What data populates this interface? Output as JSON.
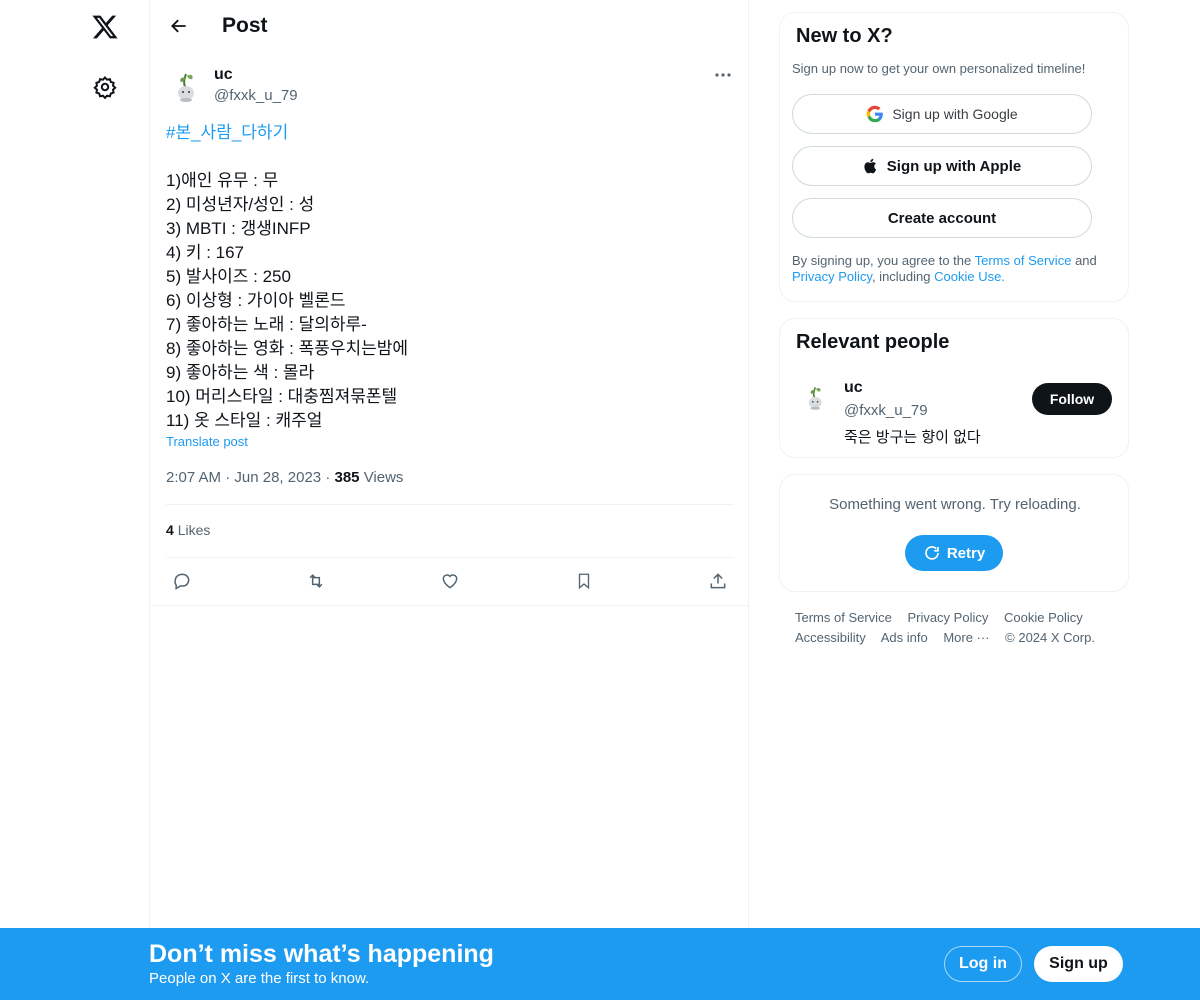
{
  "nav": {
    "logo_icon": "x-logo-icon",
    "settings_icon": "gear-icon"
  },
  "header": {
    "title": "Post"
  },
  "post": {
    "author_name": "uc",
    "author_handle": "@fxxk_u_79",
    "hashtag": "#본_사람_다하기",
    "lines": [
      "1)애인 유무 : 무",
      "2) 미성년자/성인 : 성",
      "3) MBTI : 갱생INFP",
      "4) 키 : 167",
      "5) 발사이즈 : 250",
      "6) 이상형 : 가이아 벨론드",
      "7) 좋아하는 노래 : 달의하루-",
      "8) 좋아하는 영화 : 폭풍우치는밤에",
      "9) 좋아하는 색 : 몰라",
      "10) 머리스타일 : 대충찜져묶폰텔",
      "11) 옷 스타일 : 캐주얼"
    ],
    "translate_label": "Translate post",
    "time": "2:07 AM",
    "date": "Jun 28, 2023",
    "views_count": "385",
    "views_label": "Views",
    "likes_count": "4",
    "likes_label": "Likes"
  },
  "signup_card": {
    "title": "New to X?",
    "subtitle": "Sign up now to get your own personalized timeline!",
    "google_label": "Sign up with Google",
    "apple_label": "Sign up with Apple",
    "create_label": "Create account",
    "legal_prefix": "By signing up, you agree to the",
    "terms_link": "Terms of Service",
    "and": "and",
    "privacy_link": "Privacy Policy",
    "including": ", including",
    "cookie_link": "Cookie Use."
  },
  "relevant": {
    "title": "Relevant people",
    "name": "uc",
    "handle": "@fxxk_u_79",
    "bio": "죽은 방구는 향이 없다",
    "follow_label": "Follow"
  },
  "error_card": {
    "message": "Something went wrong. Try reloading.",
    "retry_label": "Retry"
  },
  "footer": {
    "terms": "Terms of Service",
    "privacy": "Privacy Policy",
    "cookie": "Cookie Policy",
    "accessibility": "Accessibility",
    "ads": "Ads info",
    "more": "More ···",
    "copyright": "© 2024 X Corp."
  },
  "bottom_bar": {
    "title": "Don’t miss what’s happening",
    "subtitle": "People on X are the first to know.",
    "login_label": "Log in",
    "signup_label": "Sign up"
  },
  "colors": {
    "accent": "#1d9bf0",
    "text": "#0f1419",
    "muted": "#536471",
    "border": "#eff3f4"
  }
}
